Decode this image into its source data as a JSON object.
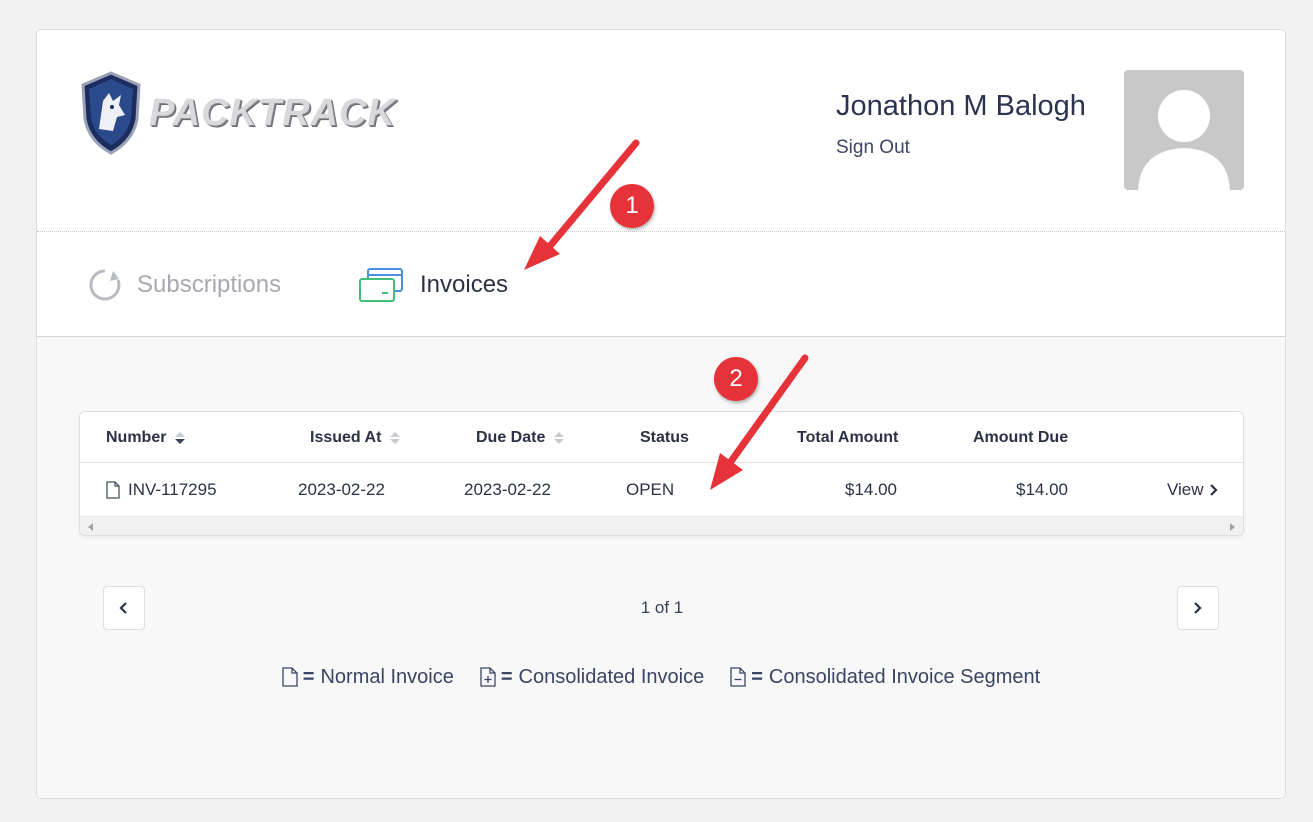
{
  "header": {
    "brand": "PACKTRACK",
    "user_name": "Jonathon M Balogh",
    "sign_out": "Sign Out"
  },
  "nav": {
    "subscriptions": "Subscriptions",
    "invoices": "Invoices"
  },
  "table": {
    "columns": [
      "Number",
      "Issued At",
      "Due Date",
      "Status",
      "Total Amount",
      "Amount Due"
    ],
    "rows": [
      {
        "number": "INV-117295",
        "issued_at": "2023-02-22",
        "due_date": "2023-02-22",
        "status": "OPEN",
        "total_amount": "$14.00",
        "amount_due": "$14.00",
        "action": "View"
      }
    ]
  },
  "pagination": {
    "label": "1 of 1"
  },
  "legend": {
    "equals": "=",
    "normal": "Normal Invoice",
    "consolidated": "Consolidated Invoice",
    "segment": "Consolidated Invoice Segment"
  },
  "annotations": {
    "badge1": "1",
    "badge2": "2",
    "color": "#e53339"
  },
  "colors": {
    "accent_green": "#3fbf7a",
    "accent_blue": "#4a90e2",
    "avatar_bg": "#c8c8c8"
  }
}
